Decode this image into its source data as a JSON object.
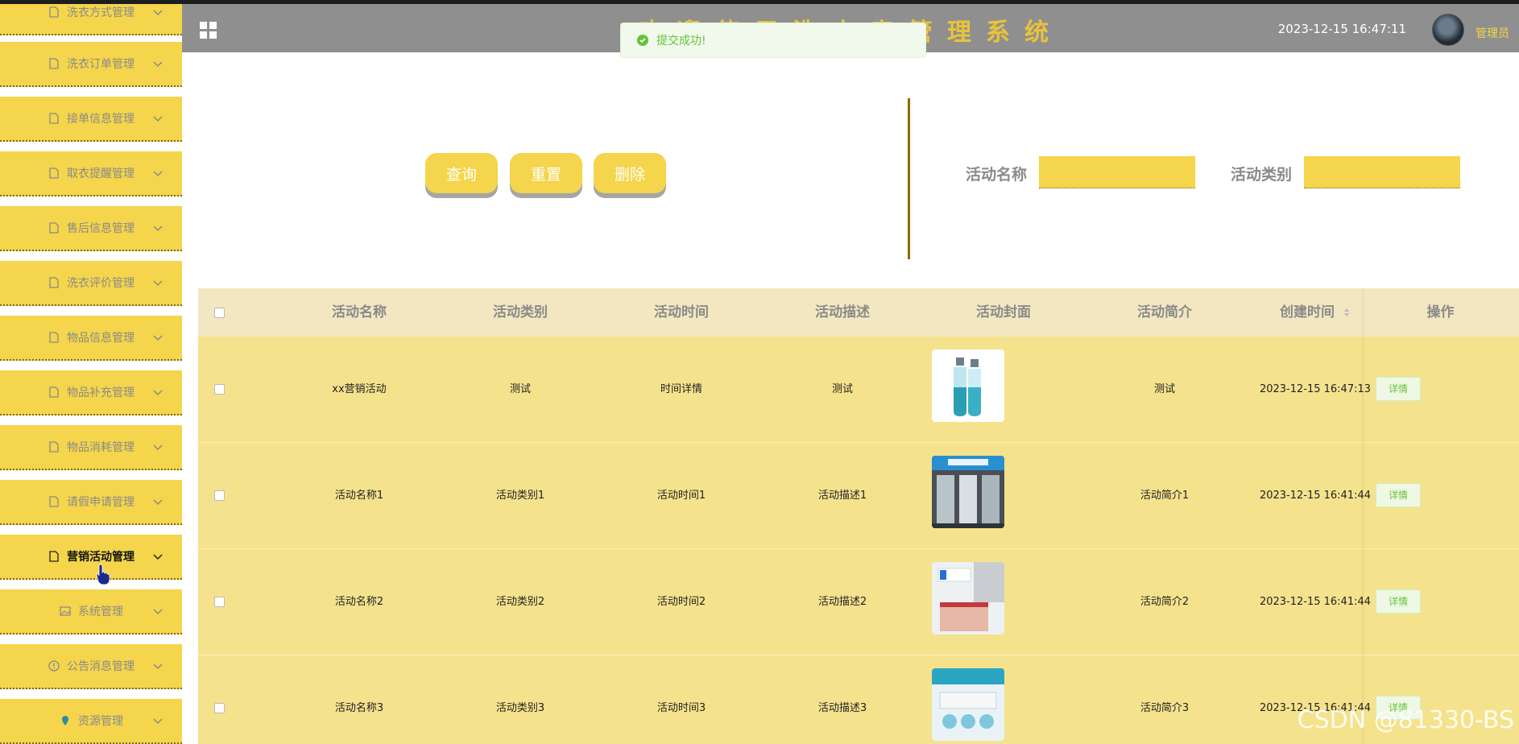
{
  "header": {
    "app_title": "欢迎使用洗衣房管理系统",
    "datetime": "2023-12-15 16:47:11",
    "user_name": "管理员"
  },
  "toast": {
    "message": "提交成功!",
    "type": "success"
  },
  "sidebar": {
    "items": [
      {
        "label": "洗衣方式管理",
        "icon": "document-icon"
      },
      {
        "label": "洗衣订单管理",
        "icon": "document-icon"
      },
      {
        "label": "接单信息管理",
        "icon": "document-icon"
      },
      {
        "label": "取衣提醒管理",
        "icon": "document-icon"
      },
      {
        "label": "售后信息管理",
        "icon": "document-icon"
      },
      {
        "label": "洗衣评价管理",
        "icon": "document-icon"
      },
      {
        "label": "物品信息管理",
        "icon": "document-icon"
      },
      {
        "label": "物品补充管理",
        "icon": "document-icon"
      },
      {
        "label": "物品消耗管理",
        "icon": "document-icon"
      },
      {
        "label": "请假申请管理",
        "icon": "document-icon"
      },
      {
        "label": "营销活动管理",
        "icon": "document-icon",
        "active": true
      },
      {
        "label": "系统管理",
        "icon": "picture-icon"
      },
      {
        "label": "公告消息管理",
        "icon": "info-icon"
      },
      {
        "label": "资源管理",
        "icon": "location-icon"
      }
    ]
  },
  "toolbar": {
    "search_label": "查询",
    "reset_label": "重置",
    "delete_label": "删除"
  },
  "filters": {
    "name_label": "活动名称",
    "name_value": "",
    "type_label": "活动类别",
    "type_value": ""
  },
  "table": {
    "columns": [
      "活动名称",
      "活动类别",
      "活动时间",
      "活动描述",
      "活动封面",
      "活动简介",
      "创建时间",
      "操作"
    ],
    "detail_label": "详情",
    "rows": [
      {
        "name": "xx营销活动",
        "type": "测试",
        "time": "时间详情",
        "desc": "测试",
        "cover": "bottles-image",
        "intro": "测试",
        "created": "2023-12-15 16:47:13"
      },
      {
        "name": "活动名称1",
        "type": "活动类别1",
        "time": "活动时间1",
        "desc": "活动描述1",
        "cover": "shopfront-image",
        "intro": "活动简介1",
        "created": "2023-12-15 16:41:44"
      },
      {
        "name": "活动名称2",
        "type": "活动类别2",
        "time": "活动时间2",
        "desc": "活动描述2",
        "cover": "reception-image",
        "intro": "活动简介2",
        "created": "2023-12-15 16:41:44"
      },
      {
        "name": "活动名称3",
        "type": "活动类别3",
        "time": "活动时间3",
        "desc": "活动描述3",
        "cover": "laundry-room-image",
        "intro": "活动简介3",
        "created": "2023-12-15 16:41:44"
      }
    ]
  },
  "watermark": "CSDN @81330-BS",
  "colors": {
    "accent": "#f4d54b",
    "header_bg": "#8f8f8f",
    "row_bg": "#f4e28d",
    "header_row_bg": "#f2e7c0",
    "success": "#67c23a"
  }
}
